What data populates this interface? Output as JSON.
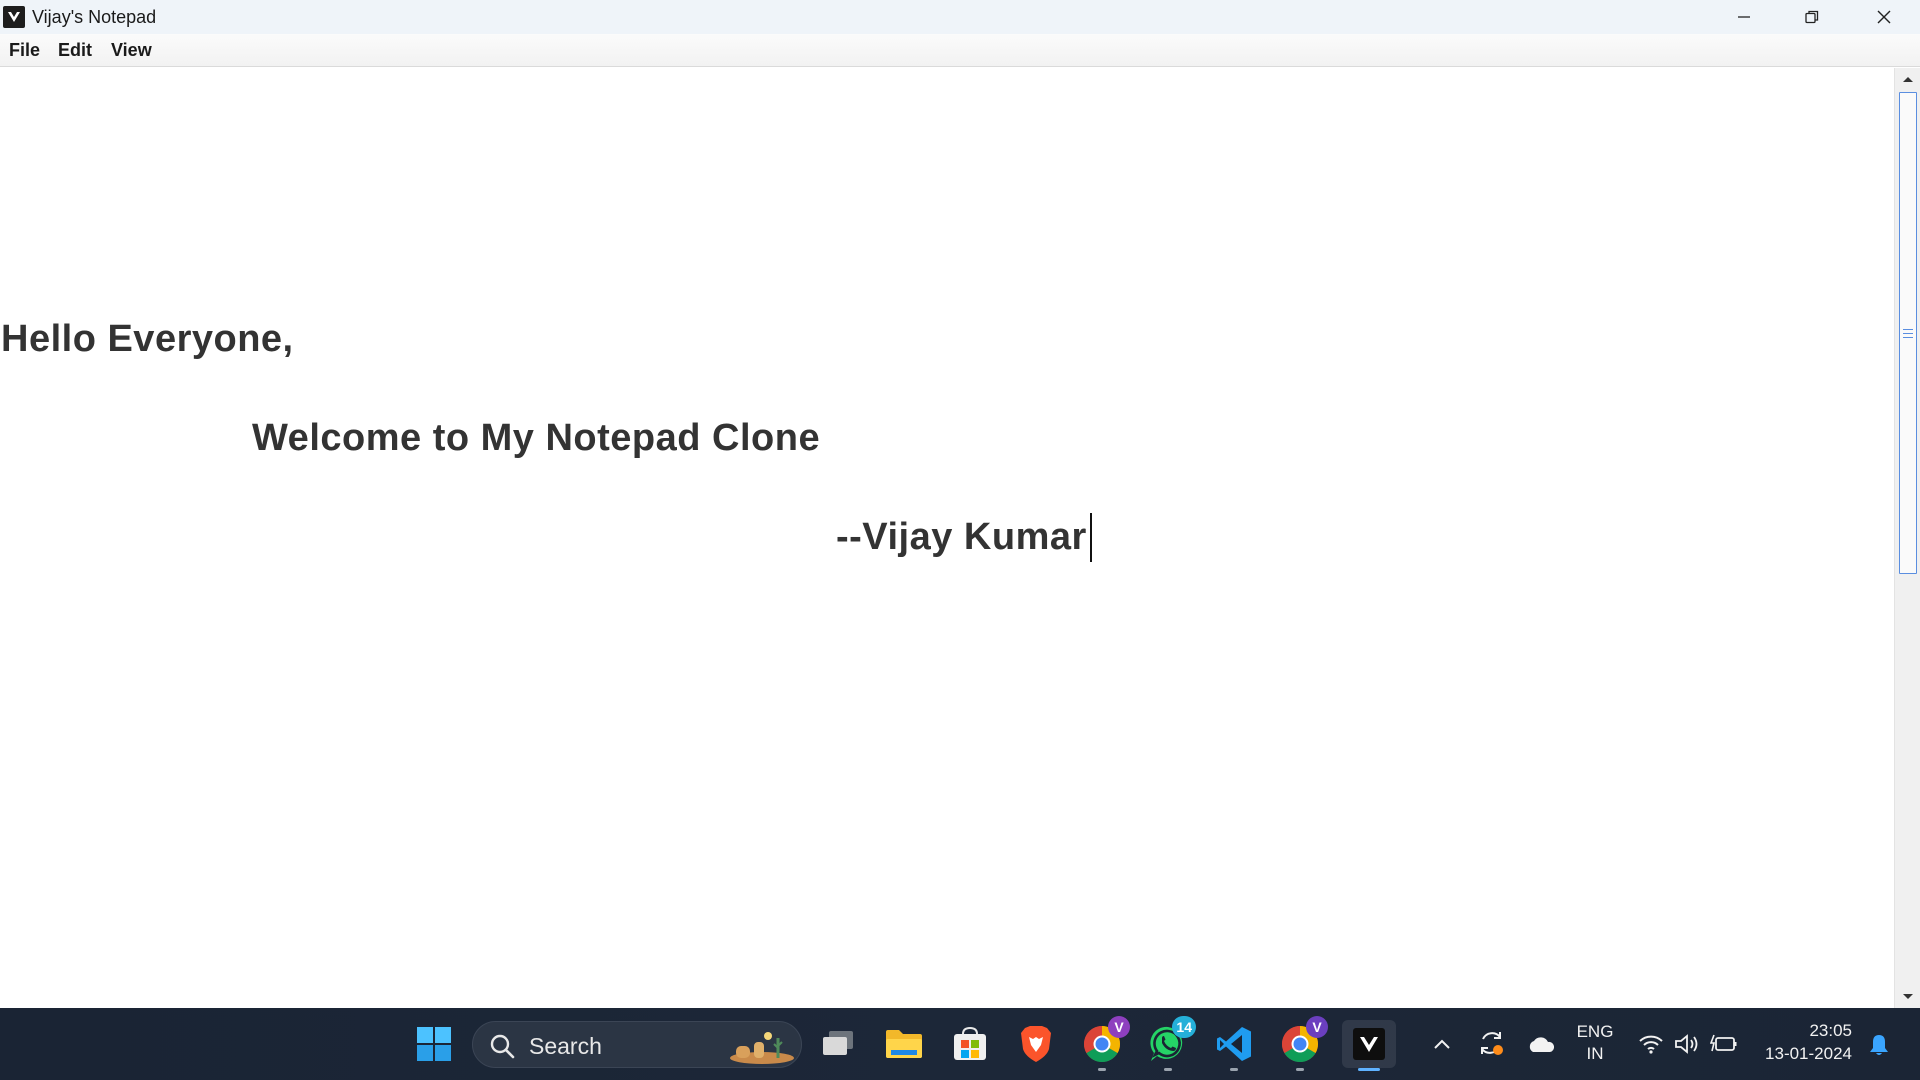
{
  "window": {
    "title": "Vijay's Notepad",
    "controls": {
      "minimize": "minimize",
      "maximize": "restore",
      "close": "close"
    }
  },
  "menu": {
    "items": [
      {
        "label": "File"
      },
      {
        "label": "Edit"
      },
      {
        "label": "View"
      }
    ]
  },
  "editor": {
    "lines": [
      "Hello Everyone,",
      "Welcome to My Notepad Clone",
      "--Vijay Kumar "
    ]
  },
  "taskbar": {
    "search_label": "Search",
    "apps": [
      {
        "name": "start",
        "icon": "windows-logo-icon"
      },
      {
        "name": "task-view",
        "icon": "task-view-icon"
      },
      {
        "name": "file-explorer",
        "icon": "folder-icon"
      },
      {
        "name": "microsoft-store",
        "icon": "store-icon"
      },
      {
        "name": "brave",
        "icon": "brave-lion-icon"
      },
      {
        "name": "chrome-profile-v",
        "icon": "chrome-icon",
        "badge": "V"
      },
      {
        "name": "whatsapp",
        "icon": "whatsapp-icon",
        "badge": "14"
      },
      {
        "name": "vscode",
        "icon": "vscode-icon"
      },
      {
        "name": "chrome-profile-v2",
        "icon": "chrome-icon",
        "badge": "V"
      },
      {
        "name": "vijays-notepad",
        "icon": "notepad-app-icon",
        "active": true
      }
    ],
    "tray": {
      "language_top": "ENG",
      "language_bottom": "IN",
      "time": "23:05",
      "date": "13-01-2024"
    }
  },
  "colors": {
    "titlebar_bg": "#eff4f9",
    "text": "#333333",
    "taskbar_bg": "#1c2738",
    "scroll_accent": "#5a8ee0",
    "whatsapp_badge": "#25b0d9",
    "chrome_badge": "#8e3fbf"
  }
}
